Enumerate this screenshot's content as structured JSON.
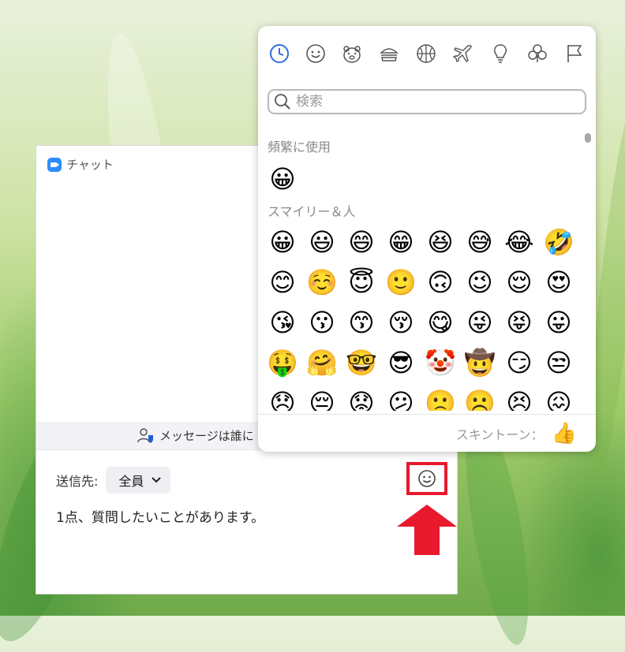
{
  "chat_window": {
    "title": "チャット",
    "notice": "メッセージは誰に",
    "to_label": "送信先:",
    "to_value": "全員",
    "message_text": "1点、質問したいことがあります。"
  },
  "emoji_picker": {
    "categories": [
      "recent-clock-icon",
      "smiley-icon",
      "animal-icon",
      "food-burger-icon",
      "ball-icon",
      "airplane-icon",
      "lightbulb-icon",
      "club-icon",
      "flag-icon"
    ],
    "search_placeholder": "検索",
    "sections": [
      {
        "label": "頻繁に使用",
        "emojis": [
          "😀"
        ]
      },
      {
        "label": "スマイリー＆人",
        "emojis": [
          "😀",
          "😃",
          "😄",
          "😁",
          "😆",
          "😅",
          "😂",
          "🤣",
          "😊",
          "☺️",
          "😇",
          "🙂",
          "🙃",
          "😉",
          "😌",
          "😍",
          "😘",
          "😗",
          "😙",
          "😚",
          "😋",
          "😜",
          "😝",
          "😛",
          "🤑",
          "🤗",
          "🤓",
          "😎",
          "🤡",
          "🤠",
          "😏",
          "😒",
          "😞",
          "😔",
          "😟",
          "😕",
          "🙁",
          "☹️",
          "😣",
          "😖"
        ]
      }
    ],
    "skin_tone_label": "スキントーン：",
    "skin_tone_emoji": "👍"
  },
  "colors": {
    "highlight_red": "#e8192c",
    "accent_blue": "#2d8cff"
  }
}
